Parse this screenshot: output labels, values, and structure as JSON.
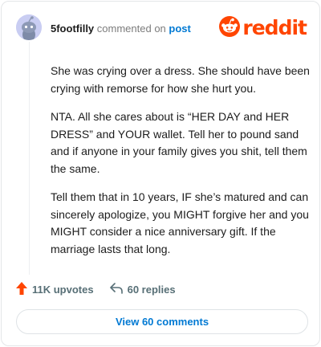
{
  "comment": {
    "username": "5footfilly",
    "action_text": "commented on",
    "target_text": "post",
    "paragraphs": [
      "She was crying over a dress. She should have been crying with remorse for how she hurt you.",
      "NTA. All she cares about is “HER DAY and HER DRESS” and YOUR wallet. Tell her to pound sand and if anyone in your family gives you shit, tell them the same.",
      "Tell them that in 10 years, IF she’s matured and can sincerely apologize, you MIGHT forgive her and you MIGHT consider a nice anniversary gift. If the marriage lasts that long."
    ],
    "upvotes": "11K upvotes",
    "replies": "60 replies",
    "view_comments": "View 60 comments"
  },
  "brand": {
    "wordmark": "reddit",
    "color": "#ff4500"
  },
  "icons": {
    "avatar": "snoo-avatar-icon",
    "logo": "reddit-logo-icon",
    "upvote": "upvote-arrow-icon",
    "reply": "reply-arrow-icon"
  },
  "colors": {
    "accent_link": "#0079d3",
    "upvote": "#ff4500",
    "avatar_bg": "#c9cdf2",
    "muted_text": "#7c7c7c"
  }
}
